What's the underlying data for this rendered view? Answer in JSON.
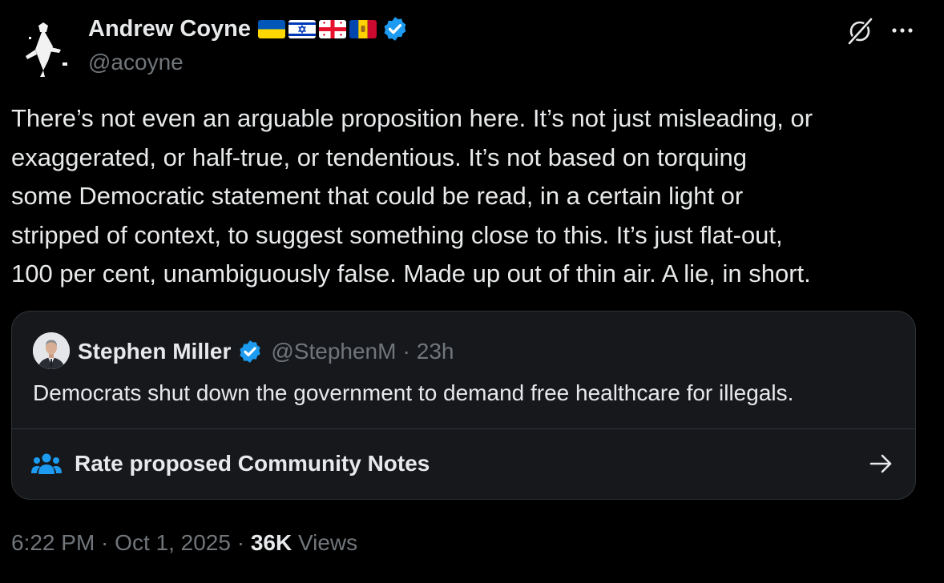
{
  "tweet": {
    "author": {
      "name": "Andrew Coyne",
      "handle": "@acoyne",
      "flags": [
        "ukraine-flag",
        "israel-flag",
        "georgia-flag",
        "moldova-flag"
      ],
      "verified_icon": "verified-badge-icon"
    },
    "text": "There’s not even an arguable proposition here. It’s not just misleading, or\nexaggerated, or half-true, or tendentious.   It’s not based on torquing\nsome Democratic statement that could be read, in a certain light or\nstripped of context, to suggest something close to  this. It’s just flat-out,\n100 per cent, unambiguously false. Made up out of thin air. A lie, in short.",
    "timestamp": "6:22 PM · Oct 1, 2025 · ",
    "views_count": "36K",
    "views_label": " Views"
  },
  "quoted": {
    "name": "Stephen Miller",
    "handle": "@StephenM",
    "separator": "·",
    "time": "23h",
    "text": "Democrats shut down the government to demand free healthcare for illegals.",
    "notes_label": "Rate proposed Community Notes"
  },
  "icons": {
    "grok": "grok-icon",
    "more": "more-icon",
    "community": "community-notes-icon",
    "arrow": "arrow-right-icon"
  },
  "colors": {
    "background": "#000000",
    "text": "#e7e9ea",
    "secondary_text": "#71767b",
    "verified_blue": "#1d9bf0",
    "card_background": "#16181c",
    "border": "#2f3336"
  }
}
